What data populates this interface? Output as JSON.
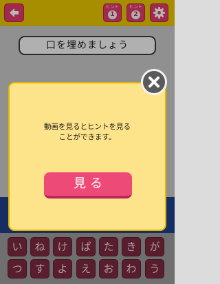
{
  "header": {
    "back_icon": "arrow-left-icon",
    "hint1": {
      "label": "ヒント",
      "number": "1"
    },
    "hint2": {
      "label": "ヒント",
      "number": "2"
    },
    "settings_icon": "gear-icon"
  },
  "question": {
    "text": "口を埋めましょう"
  },
  "keyboard": {
    "row1": [
      "い",
      "ね",
      "け",
      "ぱ",
      "た",
      "き",
      "が"
    ],
    "row2": [
      "つ",
      "す",
      "よ",
      "え",
      "お",
      "わ",
      "う"
    ]
  },
  "modal": {
    "line1": "動画を見るとヒントを見る",
    "line2": "ことができます。",
    "watch_button_label": "見る",
    "close_icon": "close-icon"
  },
  "colors": {
    "header_bg": "#e8c400",
    "accent_pink": "#e03a68",
    "modal_bg": "#fde38a",
    "button_pink": "#ee4a78",
    "keyboard_key": "#7a2a40",
    "band_blue": "#1e3f8a"
  }
}
